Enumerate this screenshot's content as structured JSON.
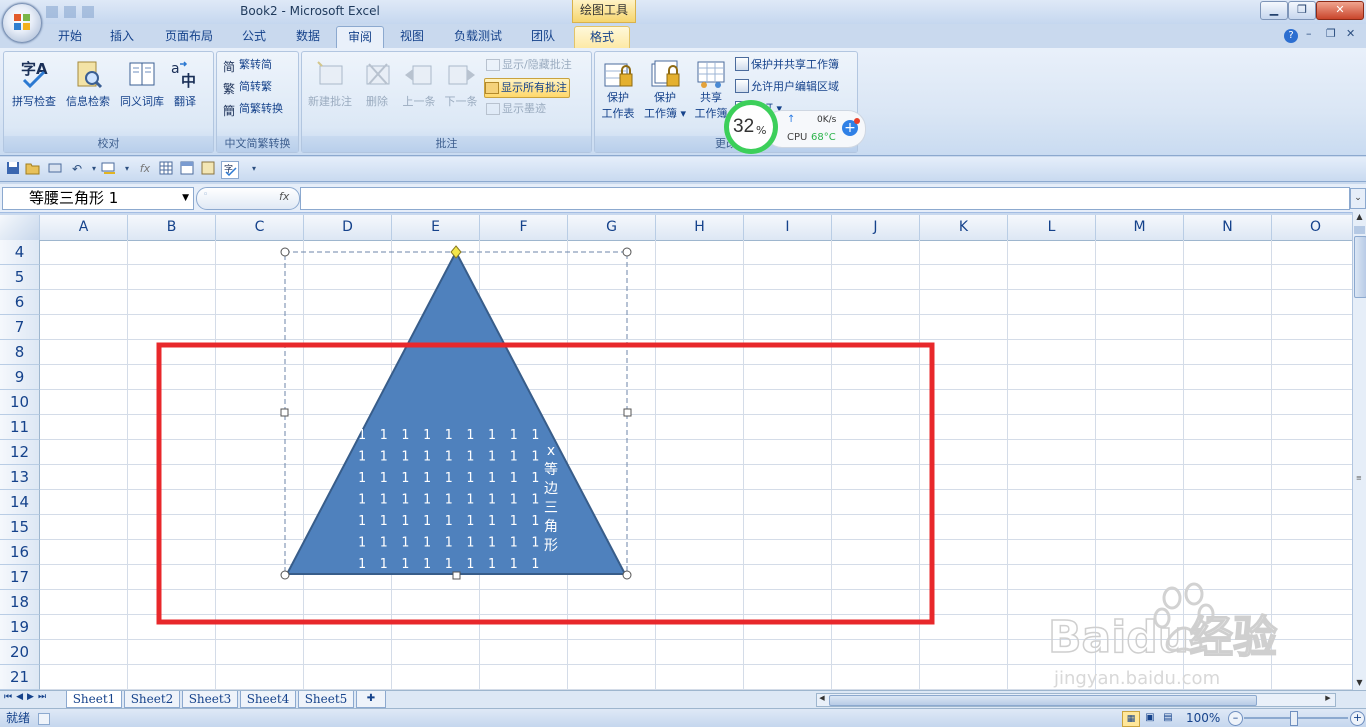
{
  "window": {
    "title": "Book2 - Microsoft Excel",
    "contextual_tab": "绘图工具"
  },
  "tabs": [
    {
      "label": "开始"
    },
    {
      "label": "插入"
    },
    {
      "label": "页面布局"
    },
    {
      "label": "公式"
    },
    {
      "label": "数据"
    },
    {
      "label": "审阅",
      "active": true
    },
    {
      "label": "视图"
    },
    {
      "label": "负载测试"
    },
    {
      "label": "团队"
    },
    {
      "label": "格式"
    }
  ],
  "ribbon": {
    "groups": {
      "proofing": {
        "label": "校对",
        "buttons": [
          "拼写检查",
          "信息检索",
          "同义词库",
          "翻译"
        ]
      },
      "chinese_conversion": {
        "label": "中文简繁转换",
        "buttons": [
          "繁转简",
          "简转繁",
          "简繁转换"
        ]
      },
      "comments": {
        "label": "批注",
        "buttons": [
          "新建批注",
          "删除",
          "上一条",
          "下一条"
        ],
        "toggles": [
          "显示/隐藏批注",
          "显示所有批注",
          "显示墨迹"
        ]
      },
      "changes": {
        "label": "更改",
        "protect_sheet": [
          "保护",
          "工作表"
        ],
        "protect_workbook": [
          "保护",
          "工作簿"
        ],
        "share_workbook": [
          "共享",
          "工作簿"
        ],
        "small": [
          "保护并共享工作簿",
          "允许用户编辑区域",
          "修订"
        ]
      }
    }
  },
  "monitor_widget": {
    "percent": "32",
    "percent_sign": "%",
    "net_speed": "0K/s",
    "cpu_label": "CPU",
    "cpu_temp": "68°C"
  },
  "formula_bar": {
    "name_box": "等腰三角形  1",
    "fx": "fx",
    "value": ""
  },
  "columns": [
    "A",
    "B",
    "C",
    "D",
    "E",
    "F",
    "G",
    "H",
    "I",
    "J",
    "K",
    "L",
    "M",
    "N",
    "O"
  ],
  "rows": [
    "4",
    "5",
    "6",
    "7",
    "8",
    "9",
    "10",
    "11",
    "12",
    "13",
    "14",
    "15",
    "16",
    "17",
    "18",
    "19",
    "20",
    "21"
  ],
  "shape": {
    "type": "isosceles-triangle",
    "fill": "#4f81bd",
    "stroke": "#385d8a",
    "text_rows": [
      "1 1 1 1 1 1 1 1 1",
      "1 1 1 1 1 1 1 1 1",
      "1 1 1 1 1 1 1 1 1",
      "1 1 1 1 1 1 1 1 1",
      "1 1 1 1 1 1 1 1 1",
      "1 1 1 1 1 1 1 1 1",
      "1 1 1 1 1 1 1 1 1"
    ],
    "vertical_text": "x\n等\n边\n三\n角\n形"
  },
  "annotation": {
    "color": "#e8282b"
  },
  "sheets": [
    {
      "label": "Sheet1",
      "active": true
    },
    {
      "label": "Sheet2"
    },
    {
      "label": "Sheet3"
    },
    {
      "label": "Sheet4"
    },
    {
      "label": "Sheet5"
    }
  ],
  "status": {
    "ready": "就绪",
    "zoom": "100%"
  },
  "watermark": {
    "brand": "Baidu经验",
    "url": "jingyan.baidu.com"
  }
}
